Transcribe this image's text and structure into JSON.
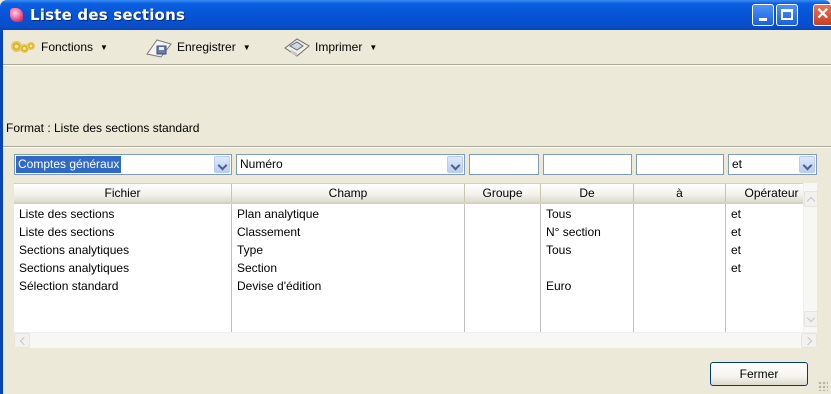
{
  "window": {
    "title": "Liste des sections"
  },
  "toolbar": {
    "functions_label": "Fonctions",
    "save_label": "Enregistrer",
    "print_label": "Imprimer"
  },
  "format_label": "Format : Liste des sections standard",
  "filters": {
    "file_combo": "Comptes généraux",
    "field_combo": "Numéro",
    "group_value": "",
    "from_value": "",
    "to_value": "",
    "operator_combo": "et"
  },
  "table": {
    "headers": [
      "Fichier",
      "Champ",
      "Groupe",
      "De",
      "à",
      "Opérateur"
    ],
    "rows": [
      [
        "Liste des sections",
        "Plan analytique",
        "",
        "Tous",
        "",
        "et"
      ],
      [
        "Liste des sections",
        "Classement",
        "",
        "N° section",
        "",
        "et"
      ],
      [
        "Sections analytiques",
        "Type",
        "",
        "Tous",
        "",
        "et"
      ],
      [
        "Sections analytiques",
        "Section",
        "",
        "",
        "",
        "et"
      ],
      [
        "Sélection standard",
        "Devise d'édition",
        "",
        "Euro",
        "",
        ""
      ]
    ]
  },
  "buttons": {
    "close_label": "Fermer"
  },
  "colors": {
    "titlebar": "#0653d6",
    "selection": "#316ac5",
    "window_bg": "#ece9d8"
  }
}
